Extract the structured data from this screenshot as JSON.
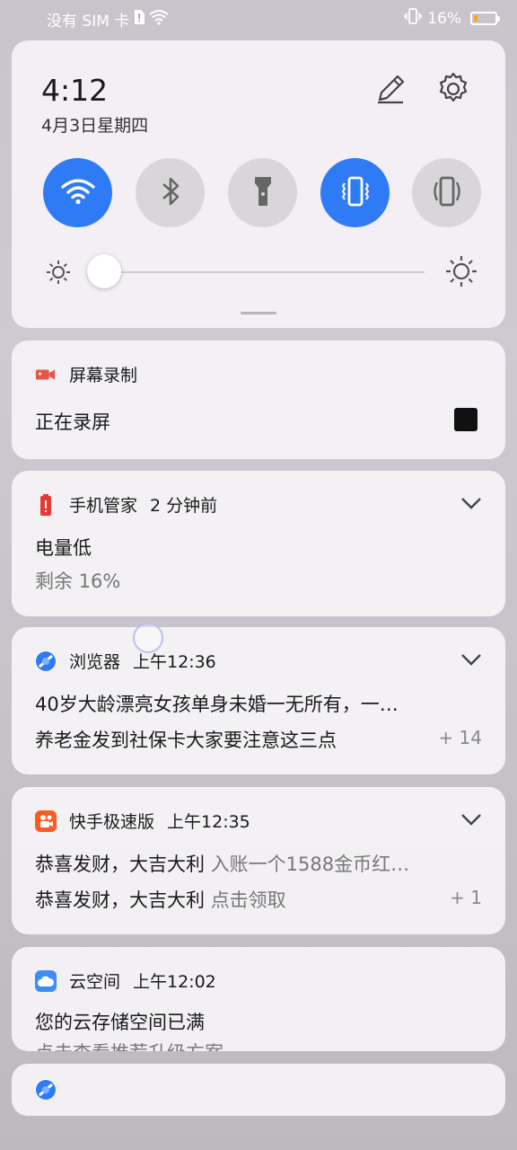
{
  "status_bar": {
    "carrier": "没有 SIM 卡",
    "battery_percent": "16%",
    "battery_level": 0.16,
    "icons": [
      "sim-alert-icon",
      "wifi-icon",
      "vibrate-icon",
      "battery-icon"
    ]
  },
  "quick_settings": {
    "time": "4:12",
    "date": "4月3日星期四",
    "toggles": [
      {
        "name": "wifi",
        "on": true
      },
      {
        "name": "bluetooth",
        "on": false
      },
      {
        "name": "flashlight",
        "on": false
      },
      {
        "name": "vibrate",
        "on": true
      },
      {
        "name": "auto-rotate",
        "on": false
      }
    ],
    "brightness_level": 0.0,
    "accent": "#2f7bf6"
  },
  "notifications": [
    {
      "app": "屏幕录制",
      "title": "正在录屏",
      "icon": "video-camera-icon"
    },
    {
      "app": "手机管家",
      "time": "2 分钟前",
      "title": "电量低",
      "subtitle": "剩余 16%",
      "icon": "battery-alert-icon"
    },
    {
      "app": "浏览器",
      "time": "上午12:36",
      "title": "40岁大龄漂亮女孩单身未婚一无所有，一…",
      "subtitle": "养老金发到社保卡大家要注意这三点",
      "count": "+ 14",
      "icon": "browser-icon"
    },
    {
      "app": "快手极速版",
      "time": "上午12:35",
      "line1_bold": "恭喜发财，大吉大利",
      "line1_rest": "入账一个1588金币红…",
      "line2_bold": "恭喜发财，大吉大利",
      "line2_rest": "点击领取",
      "count": "+ 1",
      "icon": "kuaishou-icon"
    },
    {
      "app": "云空间",
      "time": "上午12:02",
      "title": "您的云存储空间已满",
      "subtitle": "点击查看推荐升级方案",
      "icon": "cloud-icon"
    },
    {
      "app": "",
      "icon": "browser-icon"
    }
  ]
}
